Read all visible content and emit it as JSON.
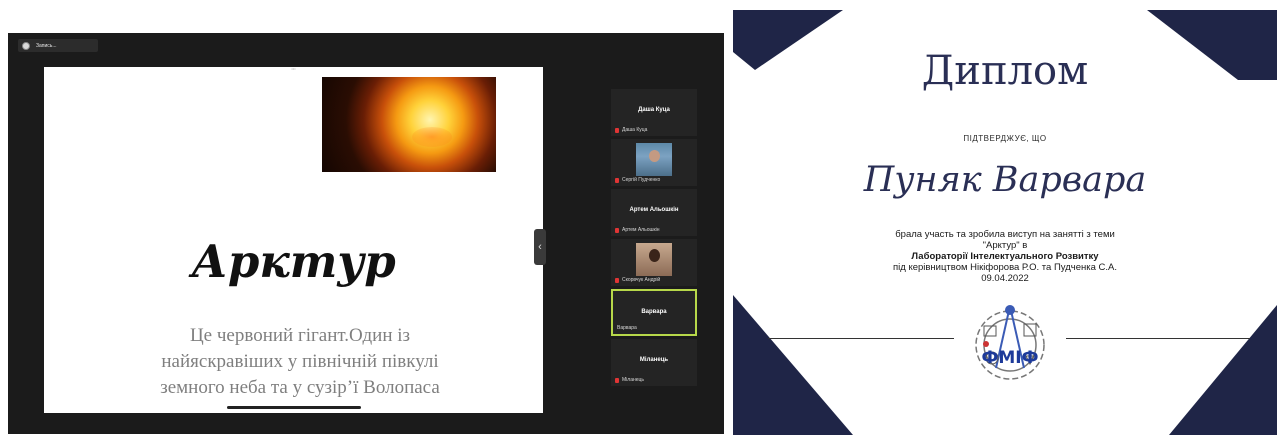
{
  "call": {
    "recording_label": "Запись...",
    "slide": {
      "top_dots": "•••",
      "title": "Арктур",
      "body_lines": [
        "Це червоний гігант.Один із",
        "найяскравіших у північній півкулі",
        "земного неба та у сузір’ї Волопаса"
      ]
    },
    "collapse_icon": "‹",
    "participants": [
      {
        "display": "Даша Куца",
        "label": "Даша Куца",
        "video": false,
        "active": false
      },
      {
        "display": "",
        "label": "Сергій Пудченко",
        "video": true,
        "active": false
      },
      {
        "display": "Артем Альошкін",
        "label": "Артем Альошкін",
        "video": false,
        "active": false
      },
      {
        "display": "",
        "label": "Скорвчук Андрій",
        "video": true,
        "active": false
      },
      {
        "display": "Варвара",
        "label": "Варвара",
        "video": false,
        "active": true
      },
      {
        "display": "Міланець",
        "label": "Міланець",
        "video": false,
        "active": false
      }
    ]
  },
  "diploma": {
    "title": "Диплом",
    "confirms": "ПІДТВЕРДЖУЄ, ЩО",
    "name": "Пуняк Варвара",
    "line1": "брала участь та зробила виступ на занятті з теми",
    "line2": "\"Арктур\" в",
    "line3": "Лабораторії Інтелектуального Розвитку",
    "line4": "під керівництвом Нікіфорова Р.О. та Пудченка С.А.",
    "date": "09.04.2022",
    "logo_text": "ФМІФ"
  },
  "colors": {
    "navy": "#1f2547",
    "active_border": "#b7d84a",
    "mic_red": "#e03535"
  },
  "icons": [
    "record-dot-icon",
    "chevron-left-icon",
    "mic-muted-icon",
    "fmif-logo-icon"
  ]
}
